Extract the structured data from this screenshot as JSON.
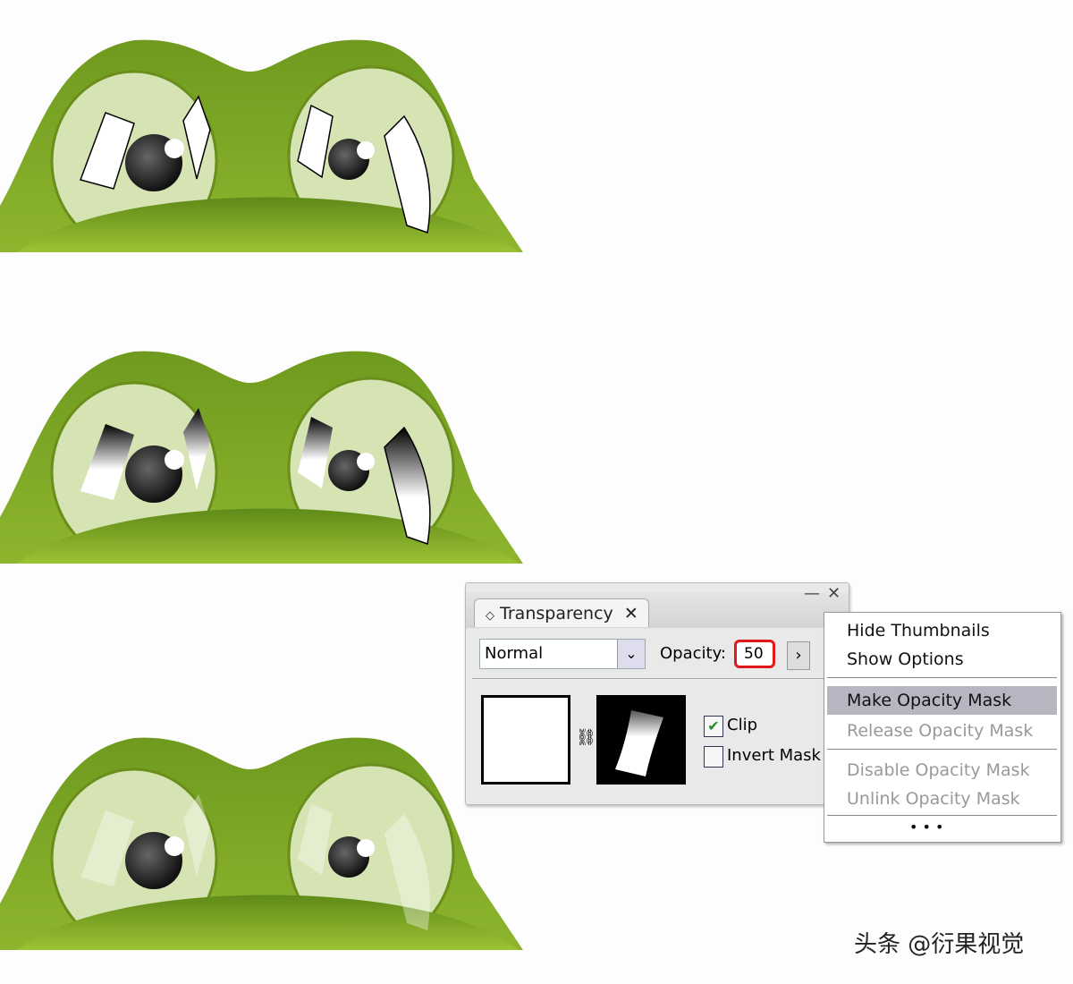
{
  "colors": {
    "frog_green": "#7ea626",
    "eye": "#d6e4b4",
    "accent_red": "#e01818"
  },
  "panel": {
    "tab_label": "Transparency",
    "tab_icon": "diamond-icon",
    "blend_mode": "Normal",
    "opacity_label": "Opacity:",
    "opacity_value": "50",
    "clip_label": "Clip",
    "clip_checked": true,
    "invert_label": "Invert Mask",
    "invert_checked": false
  },
  "menu": {
    "items": [
      {
        "label": "Hide Thumbnails",
        "enabled": true
      },
      {
        "label": "Show Options",
        "enabled": true
      },
      {
        "label": "Make Opacity Mask",
        "enabled": true,
        "highlighted": true
      },
      {
        "label": "Release Opacity Mask",
        "enabled": false
      },
      {
        "label": "Disable Opacity Mask",
        "enabled": false
      },
      {
        "label": "Unlink Opacity Mask",
        "enabled": false
      }
    ],
    "more": "• • •"
  },
  "watermark": "头条 @衍果视觉"
}
